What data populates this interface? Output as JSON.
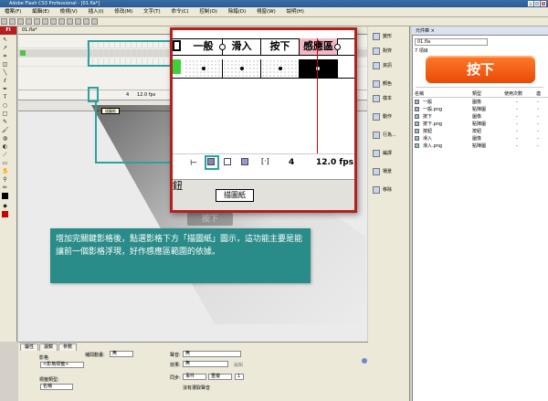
{
  "window": {
    "title": "Adobe Flash CS3 Professional - [01.fla*]",
    "logo": "Fl"
  },
  "menu": [
    "檔案(F)",
    "編輯(E)",
    "檢視(V)",
    "插入(I)",
    "修改(M)",
    "文字(T)",
    "命令(C)",
    "控制(O)",
    "除錯(D)",
    "視窗(W)",
    "說明(H)"
  ],
  "doc_tab": "01.fla*",
  "zoom": {
    "headers": [
      "一般",
      "滑入",
      "按下",
      "感應區"
    ],
    "fps": "12.0 fps",
    "frame": "4",
    "footer_label": "鈕",
    "tooltip": "描圖紙"
  },
  "small_tooltip": "描圖紙",
  "mini_fps": "12.0 fps",
  "mini_frame": "4",
  "ghost_button": "按下",
  "callout": "增加完關鍵影格後，點選影格下方「描圖紙」圖示，這功能主要是能讓前一個影格浮現，好作感應區範圍的依據。",
  "dock": [
    "變形",
    "對齊",
    "資訊",
    "顏色",
    "樣本",
    "動作",
    "行為...",
    "編譯",
    "場景",
    "移除"
  ],
  "library": {
    "title": "元件庫 ×",
    "doc": "01.fla",
    "count": "7 項目",
    "preview": "按下",
    "cols": [
      "名稱",
      "類型",
      "使用次數",
      "連"
    ],
    "items": [
      {
        "name": "一般",
        "type": "圖像"
      },
      {
        "name": "一般.png",
        "type": "點陣圖"
      },
      {
        "name": "按下",
        "type": "圖像"
      },
      {
        "name": "按下.png",
        "type": "點陣圖"
      },
      {
        "name": "按鈕",
        "type": "按鈕"
      },
      {
        "name": "滑入",
        "type": "圖像"
      },
      {
        "name": "滑入.png",
        "type": "點陣圖"
      }
    ]
  },
  "props": {
    "tabs": [
      "屬性",
      "濾鏡",
      "參數"
    ],
    "frame_label": "影格",
    "frame_name": "<影格標籤>",
    "tween_label": "補間動畫:",
    "tween_value": "無",
    "label_type_label": "標籤類型:",
    "label_type_value": "名稱",
    "sound_label": "聲音:",
    "sound_value": "無",
    "effect_label": "效果:",
    "effect_value": "無",
    "edit_label": "編輯",
    "sync_label": "同步:",
    "sync_value": "事件",
    "repeat_value": "重複",
    "repeat_count": "1",
    "no_sound": "沒有選取聲音"
  }
}
